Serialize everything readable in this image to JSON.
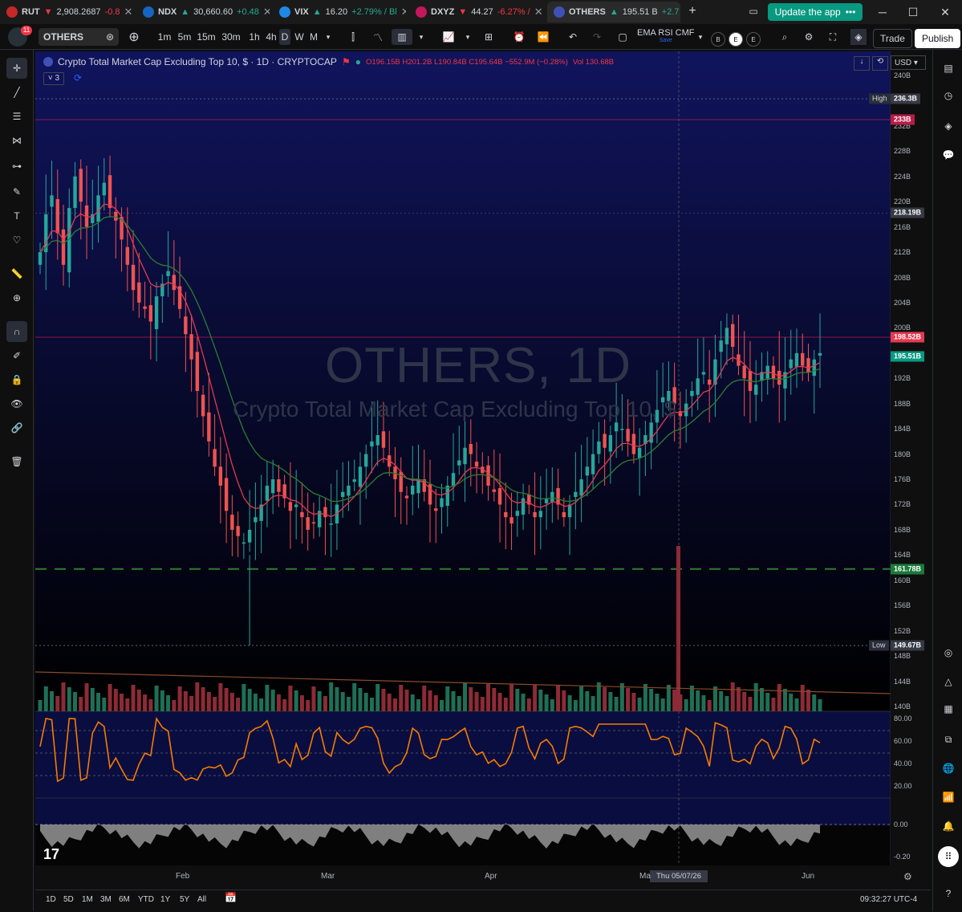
{
  "tabs": [
    {
      "symbol": "RUT",
      "price": "2,908.2687",
      "change": "-0.8",
      "dir": "neg",
      "icon_color": "#d32f2f",
      "icon": "rut-icon"
    },
    {
      "symbol": "NDX",
      "price": "30,660.60",
      "change": "+0.48",
      "dir": "pos",
      "icon_color": "#1565c0",
      "icon": "ndx-icon"
    },
    {
      "symbol": "VIX",
      "price": "16.20",
      "change": "+2.79% / Bl",
      "dir": "pos",
      "icon_color": "#1e88e5",
      "icon": "us-flag-icon"
    },
    {
      "symbol": "DXYZ",
      "price": "44.27",
      "change": "-6.27% / ",
      "dir": "neg",
      "icon_color": "#c2185b",
      "icon": "dxyz-icon"
    },
    {
      "symbol": "OTHERS",
      "price": "195.51 B",
      "change": "+2.7",
      "dir": "pos",
      "icon_color": "#3f51b5",
      "icon": "others-icon",
      "active": true
    }
  ],
  "update_label": "Update the app",
  "toolbar": {
    "symbol": "OTHERS",
    "intervals": [
      "1m",
      "5m",
      "15m",
      "30m",
      "1h",
      "4h",
      "D",
      "W",
      "M"
    ],
    "active_interval": "D",
    "indicators_label": "EMA RSI CMF",
    "indicators_sub": "Save",
    "circles": [
      "B",
      "E",
      "E"
    ],
    "trade": "Trade",
    "publish": "Publish",
    "avatar_badge": "11"
  },
  "legend": {
    "title": "Crypto Total Market Cap Excluding Top 10, $ · 1D · CRYPTOCAP",
    "ohlc": "O196.15B H201.2B L190.84B C195.64B −552.9M (−0.28%)",
    "vol": "Vol 130.68B",
    "layers": "3"
  },
  "watermark": {
    "main": "OTHERS, 1D",
    "sub": "Crypto Total Market Cap Excluding Top 10, $"
  },
  "currency": "USD",
  "price_axis": [
    "240B",
    "232B",
    "228B",
    "224B",
    "220B",
    "216B",
    "212B",
    "208B",
    "204B",
    "200B",
    "192B",
    "188B",
    "184B",
    "180B",
    "176B",
    "172B",
    "168B",
    "164B",
    "160B",
    "156B",
    "152B",
    "148B",
    "144B",
    "140B"
  ],
  "price_tags": {
    "high": {
      "label": "High",
      "value": "236.3B"
    },
    "red": "233B",
    "r2": "218.19B",
    "r3": "198.52B",
    "last": "195.51B",
    "support": "161.78B",
    "low": {
      "label": "Low",
      "value": "149.67B"
    }
  },
  "rsi_axis": [
    "80.00",
    "60.00",
    "40.00",
    "20.00"
  ],
  "cmf_axis": [
    "0.00",
    "-0.20"
  ],
  "x_axis": [
    "Feb",
    "Mar",
    "Apr",
    "Ma",
    "Jun"
  ],
  "crosshair_date": "Thu 05/07/26",
  "ranges": [
    "1D",
    "5D",
    "1M",
    "3M",
    "6M",
    "YTD",
    "1Y",
    "5Y",
    "All"
  ],
  "clock": "09:32:27 UTC-4",
  "chart_data": {
    "type": "candlestick",
    "ylim": [
      140,
      240
    ],
    "closes": [
      212,
      218,
      221,
      215,
      210,
      219,
      224,
      220,
      216,
      218,
      221,
      223,
      219,
      217,
      214,
      210,
      206,
      204,
      203,
      201,
      205,
      207,
      209,
      206,
      203,
      199,
      195,
      190,
      186,
      182,
      178,
      175,
      171,
      168,
      167,
      166,
      168,
      170,
      172,
      175,
      176,
      174,
      173,
      171,
      172,
      170,
      168,
      169,
      171,
      170,
      169,
      172,
      174,
      175,
      176,
      178,
      180,
      182,
      183,
      181,
      178,
      176,
      174,
      173,
      175,
      176,
      174,
      172,
      171,
      173,
      175,
      177,
      179,
      181,
      180,
      178,
      177,
      175,
      174,
      172,
      170,
      169,
      171,
      173,
      172,
      170,
      171,
      173,
      174,
      172,
      170,
      172,
      174,
      176,
      178,
      180,
      182,
      181,
      183,
      185,
      184,
      182,
      180,
      181,
      183,
      185,
      187,
      189,
      190,
      188,
      186,
      188,
      190,
      192,
      193,
      191,
      195,
      198,
      200,
      197,
      194,
      192,
      190,
      191,
      193,
      194,
      192,
      191,
      193,
      195,
      196,
      194,
      193,
      195,
      196
    ]
  }
}
